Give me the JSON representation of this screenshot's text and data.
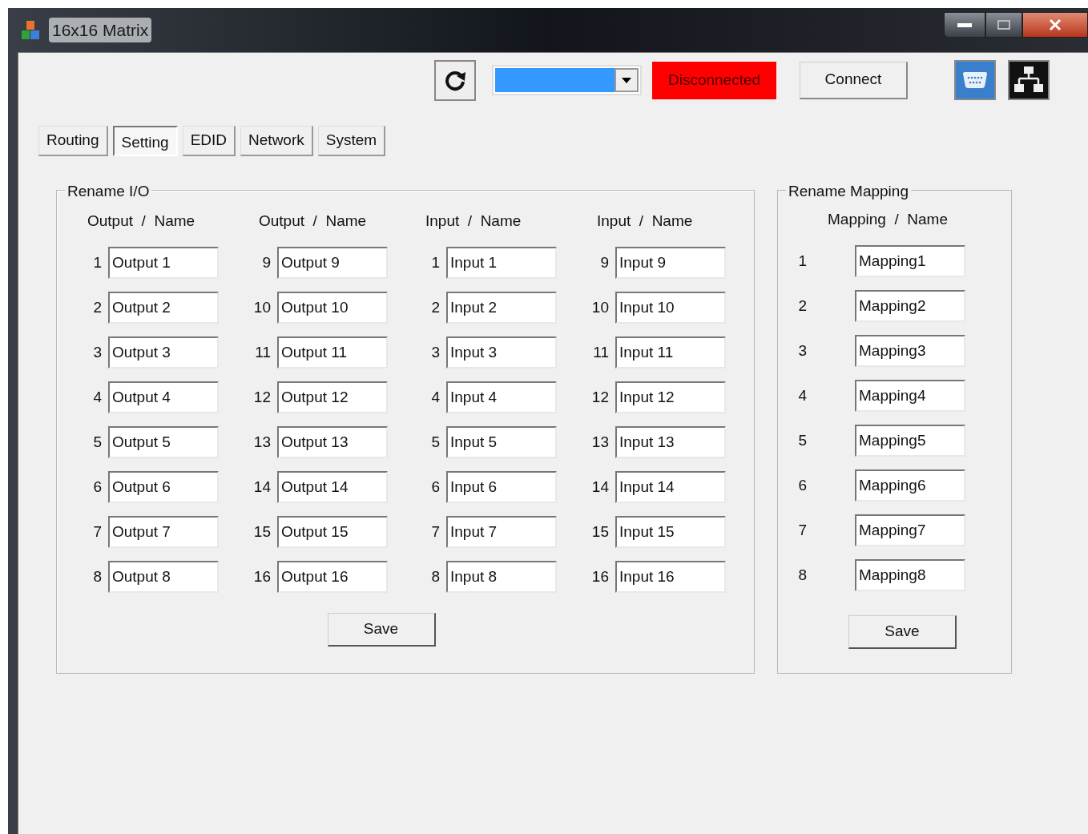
{
  "window": {
    "title": "16x16 Matrix"
  },
  "toolbar": {
    "port_select": {
      "highlighted": true
    },
    "status": {
      "label": "Disconnected",
      "connected": false
    },
    "connect_button": "Connect"
  },
  "tabs": [
    {
      "label": "Routing",
      "selected": false
    },
    {
      "label": "Setting",
      "selected": true
    },
    {
      "label": "EDID",
      "selected": false
    },
    {
      "label": "Network",
      "selected": false
    },
    {
      "label": "System",
      "selected": false
    }
  ],
  "rename_io": {
    "title": "Rename I/O",
    "columns": [
      {
        "header": "Output  /  Name",
        "rows": [
          {
            "number": "1",
            "value": "Output 1"
          },
          {
            "number": "2",
            "value": "Output 2"
          },
          {
            "number": "3",
            "value": "Output 3"
          },
          {
            "number": "4",
            "value": "Output 4"
          },
          {
            "number": "5",
            "value": "Output 5"
          },
          {
            "number": "6",
            "value": "Output 6"
          },
          {
            "number": "7",
            "value": "Output 7"
          },
          {
            "number": "8",
            "value": "Output 8"
          }
        ]
      },
      {
        "header": "Output  /  Name",
        "rows": [
          {
            "number": "9",
            "value": "Output 9"
          },
          {
            "number": "10",
            "value": "Output 10"
          },
          {
            "number": "11",
            "value": "Output 11"
          },
          {
            "number": "12",
            "value": "Output 12"
          },
          {
            "number": "13",
            "value": "Output 13"
          },
          {
            "number": "14",
            "value": "Output 14"
          },
          {
            "number": "15",
            "value": "Output 15"
          },
          {
            "number": "16",
            "value": "Output 16"
          }
        ]
      },
      {
        "header": "Input  /  Name",
        "rows": [
          {
            "number": "1",
            "value": "Input 1"
          },
          {
            "number": "2",
            "value": "Input 2"
          },
          {
            "number": "3",
            "value": "Input 3"
          },
          {
            "number": "4",
            "value": "Input 4"
          },
          {
            "number": "5",
            "value": "Input 5"
          },
          {
            "number": "6",
            "value": "Input 6"
          },
          {
            "number": "7",
            "value": "Input 7"
          },
          {
            "number": "8",
            "value": "Input 8"
          }
        ]
      },
      {
        "header": "Input  /  Name",
        "rows": [
          {
            "number": "9",
            "value": "Input 9"
          },
          {
            "number": "10",
            "value": "Input 10"
          },
          {
            "number": "11",
            "value": "Input 11"
          },
          {
            "number": "12",
            "value": "Input 12"
          },
          {
            "number": "13",
            "value": "Input 13"
          },
          {
            "number": "14",
            "value": "Input 14"
          },
          {
            "number": "15",
            "value": "Input 15"
          },
          {
            "number": "16",
            "value": "Input 16"
          }
        ]
      }
    ],
    "save_button": "Save"
  },
  "rename_mapping": {
    "title": "Rename Mapping",
    "header": "Mapping  /  Name",
    "rows": [
      {
        "number": "1",
        "value": "Mapping1"
      },
      {
        "number": "2",
        "value": "Mapping2"
      },
      {
        "number": "3",
        "value": "Mapping3"
      },
      {
        "number": "4",
        "value": "Mapping4"
      },
      {
        "number": "5",
        "value": "Mapping5"
      },
      {
        "number": "6",
        "value": "Mapping6"
      },
      {
        "number": "7",
        "value": "Mapping7"
      },
      {
        "number": "8",
        "value": "Mapping8"
      }
    ],
    "save_button": "Save"
  }
}
